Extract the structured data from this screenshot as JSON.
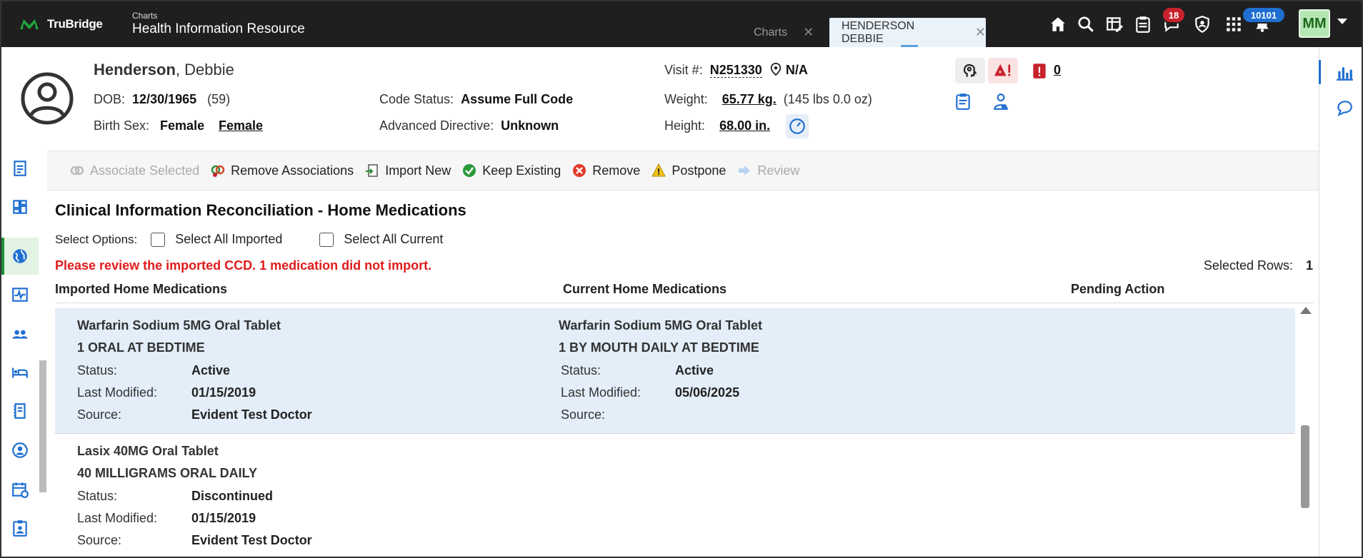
{
  "app": {
    "logo_text": "TruBridge",
    "subtitle": "Charts",
    "title": "Health Information Resource",
    "brand_color": "#1fa33b"
  },
  "tabs": [
    {
      "label": "Charts",
      "active": false
    },
    {
      "label": "HENDERSON DEBBIE",
      "active": true
    }
  ],
  "top_icons": [
    "home-icon",
    "search-icon",
    "table-edit-icon",
    "clipboard-icon",
    "messages-icon",
    "shield-icon",
    "apps-grid-icon",
    "notifications-bell-icon"
  ],
  "badges": {
    "messages": "18",
    "notifications": "10101"
  },
  "user": {
    "initials": "MM"
  },
  "patient": {
    "last_name": "Henderson",
    "first_name": ", Debbie",
    "dob_label": "DOB:",
    "dob": "12/30/1965",
    "age": "(59)",
    "birth_sex_label": "Birth Sex:",
    "birth_sex": "Female",
    "gender": "Female",
    "code_status_label": "Code Status:",
    "code_status": "Assume Full Code",
    "adv_dir_label": "Advanced Directive:",
    "adv_dir": "Unknown",
    "visit_label": "Visit #:",
    "visit": "N251330",
    "location": "N/A",
    "weight_label": "Weight:",
    "weight": "65.77 kg.",
    "weight_alt": "(145 lbs 0.0 oz)",
    "height_label": "Height:",
    "height": "68.00 in.",
    "alert_count": "0"
  },
  "toolbar": {
    "associate": "Associate Selected",
    "remove_assoc": "Remove Associations",
    "import_new": "Import New",
    "keep": "Keep Existing",
    "remove": "Remove",
    "postpone": "Postpone",
    "review": "Review"
  },
  "page": {
    "title": "Clinical Information Reconciliation - Home Medications",
    "select_options_label": "Select Options:",
    "select_all_imported": "Select All Imported",
    "select_all_current": "Select All Current",
    "warning": "Please review the imported CCD. 1 medication did not import.",
    "selected_rows_label": "Selected Rows:",
    "selected_rows": "1"
  },
  "columns": {
    "imported": "Imported Home Medications",
    "current": "Current Home Medications",
    "pending": "Pending Action"
  },
  "labels": {
    "status": "Status:",
    "last_modified": "Last Modified:",
    "source": "Source:"
  },
  "rows": [
    {
      "selected": true,
      "imported": {
        "name": "Warfarin Sodium 5MG Oral Tablet",
        "sig": "1 ORAL AT BEDTIME",
        "status": "Active",
        "last_modified": "01/15/2019",
        "source": "Evident Test Doctor"
      },
      "current": {
        "name": "Warfarin Sodium 5MG Oral Tablet",
        "sig": "1 BY MOUTH DAILY AT BEDTIME",
        "status": "Active",
        "last_modified": "05/06/2025",
        "source": ""
      }
    },
    {
      "selected": false,
      "imported": {
        "name": "Lasix 40MG Oral Tablet",
        "sig": "40 MILLIGRAMS ORAL DAILY",
        "status": "Discontinued",
        "last_modified": "01/15/2019",
        "source": "Evident Test Doctor"
      }
    }
  ]
}
